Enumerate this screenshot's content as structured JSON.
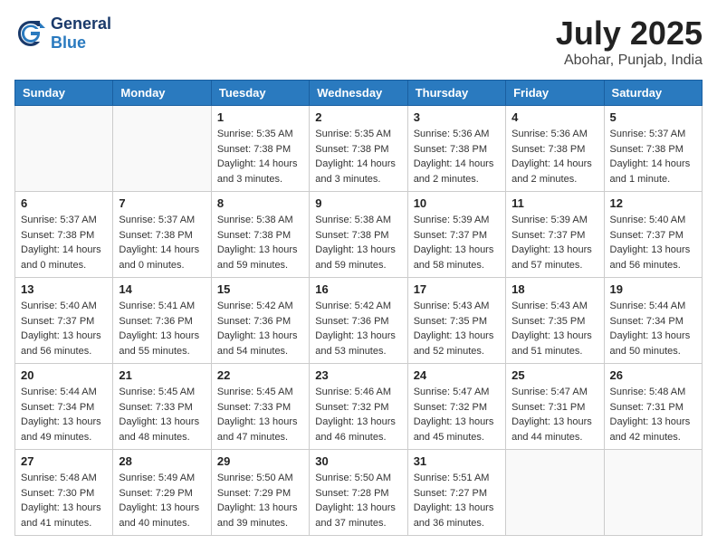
{
  "header": {
    "logo_general": "General",
    "logo_blue": "Blue",
    "month": "July 2025",
    "location": "Abohar, Punjab, India"
  },
  "days_of_week": [
    "Sunday",
    "Monday",
    "Tuesday",
    "Wednesday",
    "Thursday",
    "Friday",
    "Saturday"
  ],
  "weeks": [
    [
      {
        "day": "",
        "info": ""
      },
      {
        "day": "",
        "info": ""
      },
      {
        "day": "1",
        "info": "Sunrise: 5:35 AM\nSunset: 7:38 PM\nDaylight: 14 hours and 3 minutes."
      },
      {
        "day": "2",
        "info": "Sunrise: 5:35 AM\nSunset: 7:38 PM\nDaylight: 14 hours and 3 minutes."
      },
      {
        "day": "3",
        "info": "Sunrise: 5:36 AM\nSunset: 7:38 PM\nDaylight: 14 hours and 2 minutes."
      },
      {
        "day": "4",
        "info": "Sunrise: 5:36 AM\nSunset: 7:38 PM\nDaylight: 14 hours and 2 minutes."
      },
      {
        "day": "5",
        "info": "Sunrise: 5:37 AM\nSunset: 7:38 PM\nDaylight: 14 hours and 1 minute."
      }
    ],
    [
      {
        "day": "6",
        "info": "Sunrise: 5:37 AM\nSunset: 7:38 PM\nDaylight: 14 hours and 0 minutes."
      },
      {
        "day": "7",
        "info": "Sunrise: 5:37 AM\nSunset: 7:38 PM\nDaylight: 14 hours and 0 minutes."
      },
      {
        "day": "8",
        "info": "Sunrise: 5:38 AM\nSunset: 7:38 PM\nDaylight: 13 hours and 59 minutes."
      },
      {
        "day": "9",
        "info": "Sunrise: 5:38 AM\nSunset: 7:38 PM\nDaylight: 13 hours and 59 minutes."
      },
      {
        "day": "10",
        "info": "Sunrise: 5:39 AM\nSunset: 7:37 PM\nDaylight: 13 hours and 58 minutes."
      },
      {
        "day": "11",
        "info": "Sunrise: 5:39 AM\nSunset: 7:37 PM\nDaylight: 13 hours and 57 minutes."
      },
      {
        "day": "12",
        "info": "Sunrise: 5:40 AM\nSunset: 7:37 PM\nDaylight: 13 hours and 56 minutes."
      }
    ],
    [
      {
        "day": "13",
        "info": "Sunrise: 5:40 AM\nSunset: 7:37 PM\nDaylight: 13 hours and 56 minutes."
      },
      {
        "day": "14",
        "info": "Sunrise: 5:41 AM\nSunset: 7:36 PM\nDaylight: 13 hours and 55 minutes."
      },
      {
        "day": "15",
        "info": "Sunrise: 5:42 AM\nSunset: 7:36 PM\nDaylight: 13 hours and 54 minutes."
      },
      {
        "day": "16",
        "info": "Sunrise: 5:42 AM\nSunset: 7:36 PM\nDaylight: 13 hours and 53 minutes."
      },
      {
        "day": "17",
        "info": "Sunrise: 5:43 AM\nSunset: 7:35 PM\nDaylight: 13 hours and 52 minutes."
      },
      {
        "day": "18",
        "info": "Sunrise: 5:43 AM\nSunset: 7:35 PM\nDaylight: 13 hours and 51 minutes."
      },
      {
        "day": "19",
        "info": "Sunrise: 5:44 AM\nSunset: 7:34 PM\nDaylight: 13 hours and 50 minutes."
      }
    ],
    [
      {
        "day": "20",
        "info": "Sunrise: 5:44 AM\nSunset: 7:34 PM\nDaylight: 13 hours and 49 minutes."
      },
      {
        "day": "21",
        "info": "Sunrise: 5:45 AM\nSunset: 7:33 PM\nDaylight: 13 hours and 48 minutes."
      },
      {
        "day": "22",
        "info": "Sunrise: 5:45 AM\nSunset: 7:33 PM\nDaylight: 13 hours and 47 minutes."
      },
      {
        "day": "23",
        "info": "Sunrise: 5:46 AM\nSunset: 7:32 PM\nDaylight: 13 hours and 46 minutes."
      },
      {
        "day": "24",
        "info": "Sunrise: 5:47 AM\nSunset: 7:32 PM\nDaylight: 13 hours and 45 minutes."
      },
      {
        "day": "25",
        "info": "Sunrise: 5:47 AM\nSunset: 7:31 PM\nDaylight: 13 hours and 44 minutes."
      },
      {
        "day": "26",
        "info": "Sunrise: 5:48 AM\nSunset: 7:31 PM\nDaylight: 13 hours and 42 minutes."
      }
    ],
    [
      {
        "day": "27",
        "info": "Sunrise: 5:48 AM\nSunset: 7:30 PM\nDaylight: 13 hours and 41 minutes."
      },
      {
        "day": "28",
        "info": "Sunrise: 5:49 AM\nSunset: 7:29 PM\nDaylight: 13 hours and 40 minutes."
      },
      {
        "day": "29",
        "info": "Sunrise: 5:50 AM\nSunset: 7:29 PM\nDaylight: 13 hours and 39 minutes."
      },
      {
        "day": "30",
        "info": "Sunrise: 5:50 AM\nSunset: 7:28 PM\nDaylight: 13 hours and 37 minutes."
      },
      {
        "day": "31",
        "info": "Sunrise: 5:51 AM\nSunset: 7:27 PM\nDaylight: 13 hours and 36 minutes."
      },
      {
        "day": "",
        "info": ""
      },
      {
        "day": "",
        "info": ""
      }
    ]
  ]
}
